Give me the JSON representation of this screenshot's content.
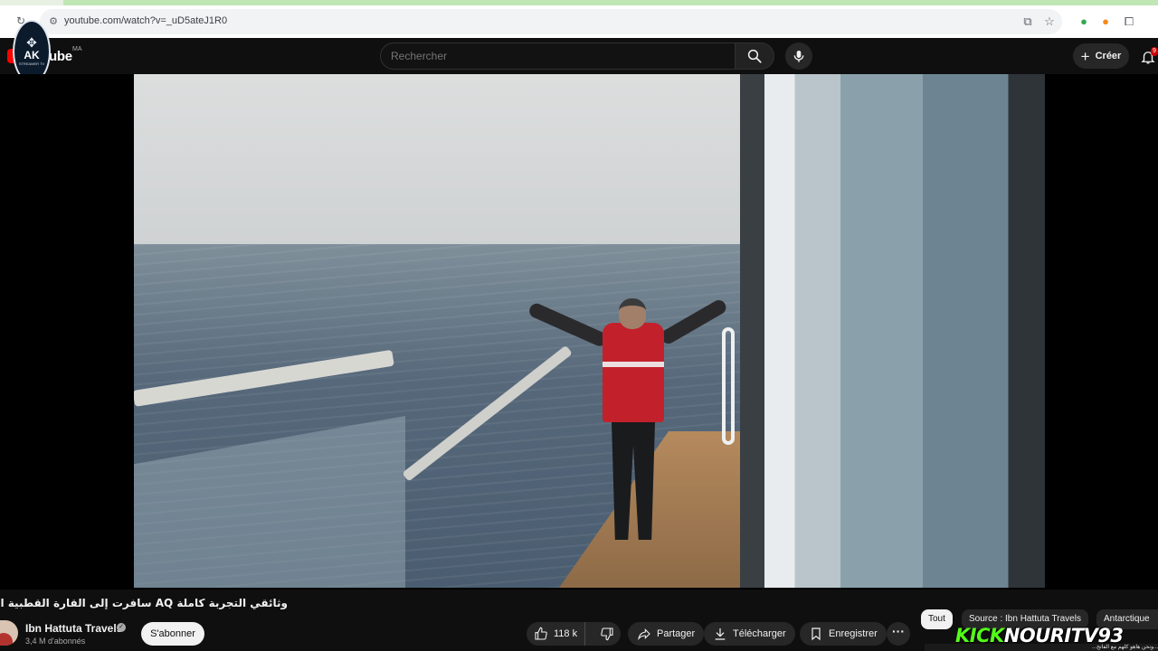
{
  "browser": {
    "url": "youtube.com/watch?v=_uD5ateJ1R0"
  },
  "header": {
    "logo_text": "YouTube",
    "country_code": "MA",
    "search_placeholder": "Rechercher",
    "create_label": "Créer",
    "notification_count": "9"
  },
  "overlay_badge": {
    "title": "AK",
    "subtitle": "STREAMER TV"
  },
  "video": {
    "title": "وثائقي التجربة كاملة AQ سافرت إلى القارة القطبية المتجمدة أنتاركتيكا",
    "channel_name": "Ibn Hattuta Travels",
    "subscribers": "3,4 M d'abonnés",
    "subscribe_label": "S'abonner",
    "likes": "118 k",
    "share_label": "Partager",
    "download_label": "Télécharger",
    "save_label": "Enregistrer"
  },
  "chips": [
    {
      "label": "Tout"
    },
    {
      "label": "Source : Ibn Hattuta Travels"
    },
    {
      "label": "Antarctique"
    }
  ],
  "stream_overlay": {
    "kick_text": "KICK",
    "handle": "NOURITV93",
    "ticker": "...ونحن هاهو كلهم مع الفاتح..."
  },
  "colors": {
    "background": "#0f0f0f",
    "youtube_red": "#ff0000",
    "kick_green": "#53fc18"
  }
}
